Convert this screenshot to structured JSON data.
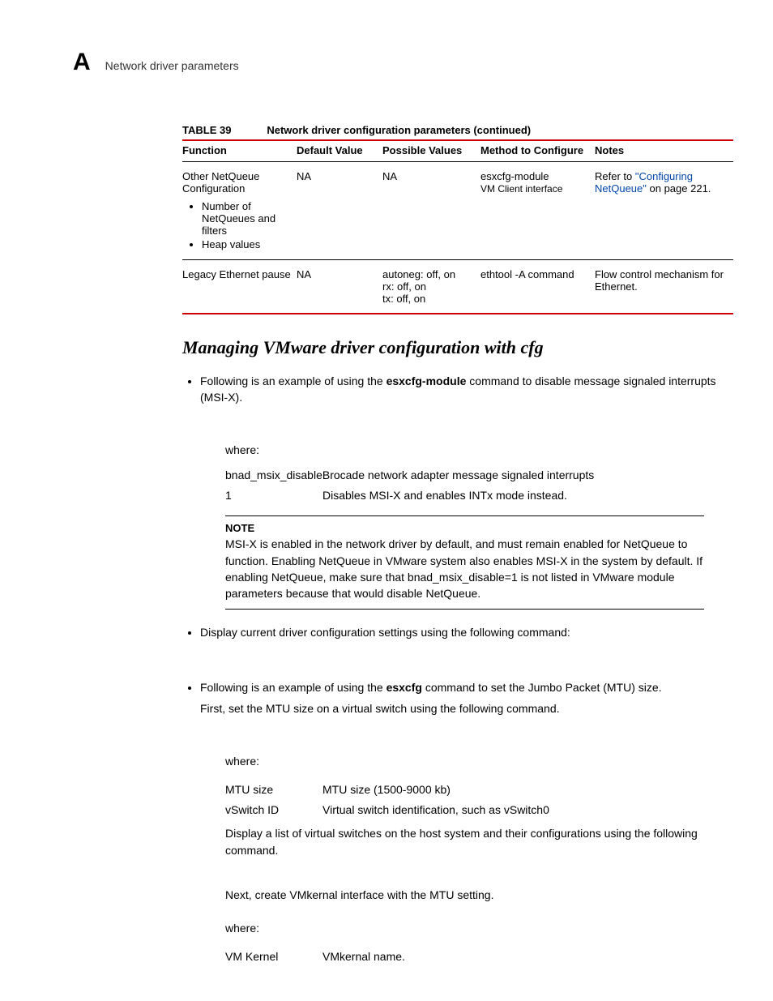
{
  "header": {
    "chapter_letter": "A",
    "running_title": "Network driver parameters"
  },
  "table": {
    "label": "TABLE 39",
    "title": "Network driver configuration parameters (continued)",
    "columns": [
      "Function",
      "Default Value",
      "Possible Values",
      "Method to Configure",
      "Notes"
    ],
    "rows": [
      {
        "function_main": "Other NetQueue Configuration",
        "function_items": [
          "Number of NetQueues and filters",
          "Heap values"
        ],
        "default_value": "NA",
        "possible_values": "NA",
        "method_line1": "esxcfg-module",
        "method_line2": "VM Client interface",
        "notes_prefix": "Refer to ",
        "notes_link": "\"Configuring NetQueue\"",
        "notes_suffix": " on page 221."
      },
      {
        "function_main": "Legacy Ethernet pause",
        "default_value": "NA",
        "possible_values": "autoneg: off, on\nrx: off, on\ntx: off, on",
        "method": "ethtool -A command",
        "notes": "Flow control mechanism for Ethernet."
      }
    ]
  },
  "section_heading": "Managing VMware driver configuration with cfg",
  "bullets": {
    "b1_prefix": "Following is an example of using the ",
    "b1_bold": "esxcfg-module",
    "b1_suffix": " command to disable message signaled interrupts (MSI-X).",
    "b2": "Display current driver configuration settings using the following command:",
    "b3_prefix": "Following is an example of using the ",
    "b3_bold": "esxcfg",
    "b3_suffix": " command to set the Jumbo Packet (MTU) size.",
    "b3_line2": "First, set the MTU size on a virtual switch using the following command."
  },
  "where_label": "where:",
  "defs1": [
    {
      "term": "bnad_msix_disable",
      "desc": "Brocade network adapter message signaled interrupts"
    },
    {
      "term": "1",
      "desc": "Disables MSI-X and enables INTx mode instead."
    }
  ],
  "note": {
    "title": "NOTE",
    "body": "MSI-X is enabled in the network driver by default, and must remain enabled for NetQueue to function. Enabling NetQueue in VMware system also enables MSI-X in the system by default. If enabling NetQueue, make sure that bnad_msix_disable=1 is not listed in VMware module parameters because that would disable NetQueue."
  },
  "defs2": [
    {
      "term": "MTU size",
      "desc": "MTU size (1500-9000 kb)"
    },
    {
      "term": "vSwitch ID",
      "desc": "Virtual switch identification, such as vSwitch0"
    }
  ],
  "para_display_list": "Display a list of virtual switches on the host system and their configurations using the following command.",
  "para_next_create": "Next, create VMkernal interface with the MTU setting.",
  "defs3": [
    {
      "term": "VM Kernel",
      "desc": "VMkernal name."
    }
  ]
}
